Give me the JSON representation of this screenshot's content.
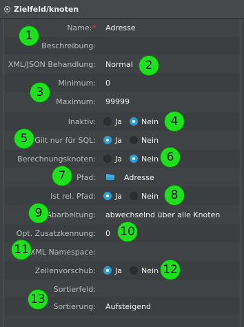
{
  "header": {
    "title": "Zielfeld/knoten"
  },
  "fields": {
    "name": {
      "label": "Name:",
      "required_mark": "*",
      "value": "Adresse"
    },
    "beschreibung": {
      "label": "Beschreibung:",
      "value": ""
    },
    "behandlung": {
      "label": "XML/JSON Behandlung:",
      "value": "Normal"
    },
    "minimum": {
      "label": "Minimum:",
      "value": "0"
    },
    "maximum": {
      "label": "Maximum:",
      "value": "99999"
    },
    "inaktiv": {
      "label": "Inaktiv:",
      "options": [
        "Ja",
        "Nein"
      ],
      "selected": "Nein"
    },
    "sql": {
      "label": "Gilt nur für SQL:",
      "options": [
        "Ja",
        "Nein"
      ],
      "selected": "Ja"
    },
    "berechnung": {
      "label": "Berechnungsknoten:",
      "options": [
        "Ja",
        "Nein"
      ],
      "selected": "Nein"
    },
    "pfad": {
      "label": "Pfad:",
      "value": "Adresse",
      "icon": "folder-icon"
    },
    "relpfad": {
      "label": "Ist rel. Pfad:",
      "options": [
        "Ja",
        "Nein"
      ],
      "selected": "Ja"
    },
    "abarbeitung": {
      "label": "Abarbeitung:",
      "value": "abwechselnd über alle Knoten"
    },
    "zusatz": {
      "label": "Opt. Zusatzkennung:",
      "value": "0"
    },
    "namespace": {
      "label": "XML Namespace:",
      "value": ""
    },
    "zeilenvorschub": {
      "label": "Zeilenvorschub:",
      "options": [
        "Ja",
        "Nein"
      ],
      "selected": "Ja"
    },
    "sortierfeld": {
      "label": "Sortierfeld:",
      "value": ""
    },
    "sortierung": {
      "label": "Sortierung:",
      "value": "Aufsteigend"
    }
  },
  "badges": [
    "1",
    "2",
    "3",
    "4",
    "5",
    "6",
    "7",
    "8",
    "9",
    "10",
    "11",
    "12",
    "13"
  ],
  "colors": {
    "background": "#3f4244",
    "label": "#b9bcbe",
    "value": "#f0f0f0",
    "radio_checked": "#2a9fd6",
    "required": "#e0483a",
    "badge": "#1fe01f",
    "folder": "#3aa0dc"
  }
}
